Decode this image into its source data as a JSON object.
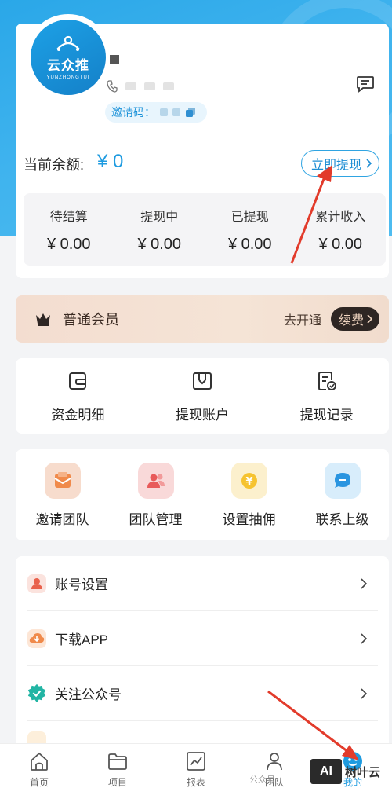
{
  "profile": {
    "brand_name": "云众推",
    "brand_sub": "YUNZHONGTUI",
    "invite_label": "邀请码："
  },
  "balance": {
    "label": "当前余额:",
    "value": "¥ 0",
    "withdraw_label": "立即提现"
  },
  "stats": [
    {
      "label": "待结算",
      "value": "¥ 0.00"
    },
    {
      "label": "提现中",
      "value": "¥ 0.00"
    },
    {
      "label": "已提现",
      "value": "¥ 0.00"
    },
    {
      "label": "累计收入",
      "value": "¥ 0.00"
    }
  ],
  "member": {
    "title": "普通会员",
    "open_label": "去开通",
    "renew_label": "续费"
  },
  "fund_menu": [
    {
      "label": "资金明细",
      "icon": "wallet-icon"
    },
    {
      "label": "提现账户",
      "icon": "account-icon"
    },
    {
      "label": "提现记录",
      "icon": "record-icon"
    }
  ],
  "team_menu": [
    {
      "label": "邀请团队",
      "icon": "invite-team-icon",
      "color": "#f6d6c7"
    },
    {
      "label": "团队管理",
      "icon": "team-manage-icon",
      "color": "#f8d5d5"
    },
    {
      "label": "设置抽佣",
      "icon": "commission-icon",
      "color": "#fbefc9"
    },
    {
      "label": "联系上级",
      "icon": "contact-icon",
      "color": "#d6ecfb"
    }
  ],
  "settings_list": [
    {
      "label": "账号设置",
      "icon": "user-icon"
    },
    {
      "label": "下载APP",
      "icon": "download-icon"
    },
    {
      "label": "关注公众号",
      "icon": "verified-icon"
    }
  ],
  "tabbar": [
    {
      "label": "首页",
      "icon": "home-icon"
    },
    {
      "label": "项目",
      "icon": "folder-icon"
    },
    {
      "label": "报表",
      "icon": "report-icon"
    },
    {
      "label": "团队",
      "icon": "team-tab-icon"
    },
    {
      "label": "我的",
      "icon": "mine-icon"
    }
  ],
  "watermark": {
    "left_text": "公众号",
    "box_text": "AI",
    "text": "树叶云"
  },
  "colors": {
    "primary": "#1e9be0",
    "member_dark": "#2e2623",
    "arrow": "#e23b2b"
  }
}
